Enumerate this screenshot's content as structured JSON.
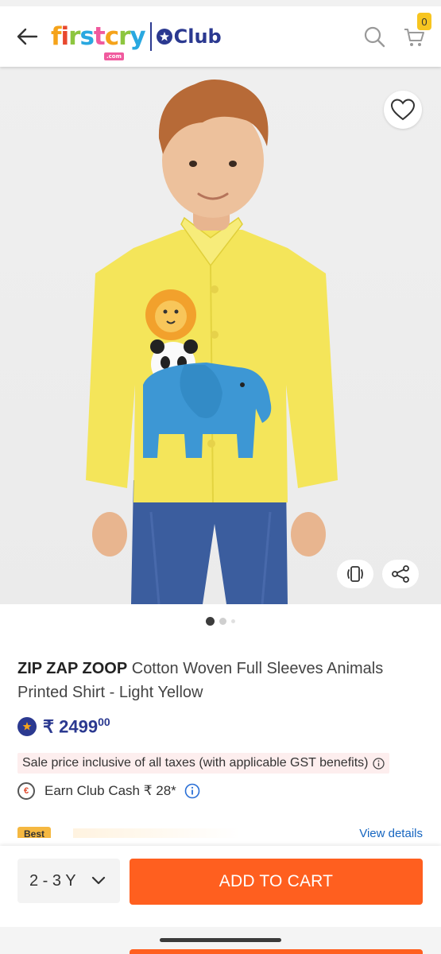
{
  "header": {
    "back_icon": "arrow-left-icon",
    "logo_text": "firstcry",
    "logo_sub": ".com",
    "club_text": "Club",
    "search_icon": "search-icon",
    "cart_icon": "cart-icon",
    "cart_count": "0"
  },
  "product_image": {
    "wishlist_icon": "heart-icon",
    "view_3d_icon": "rotate-view-icon",
    "share_icon": "share-icon",
    "image_count": 3,
    "active_image": 1
  },
  "product": {
    "brand": "ZIP ZAP ZOOP",
    "name": " Cotton Woven Full Sleeves Animals Printed Shirt - Light Yellow",
    "currency": "₹",
    "price_main": "2499",
    "price_decimal": "00",
    "tax_note": "Sale price inclusive of all taxes (with applicable GST benefits)",
    "earn_text": "Earn Club Cash ₹ 28*",
    "best_tag": "Best",
    "view_details": "View details"
  },
  "bottom_bar": {
    "size": "2 - 3 Y",
    "add_to_cart": "ADD TO CART"
  },
  "colors": {
    "brand_blue": "#2b3990",
    "cta_orange": "#ff5f1f",
    "shirt_yellow": "#f4e55a"
  }
}
